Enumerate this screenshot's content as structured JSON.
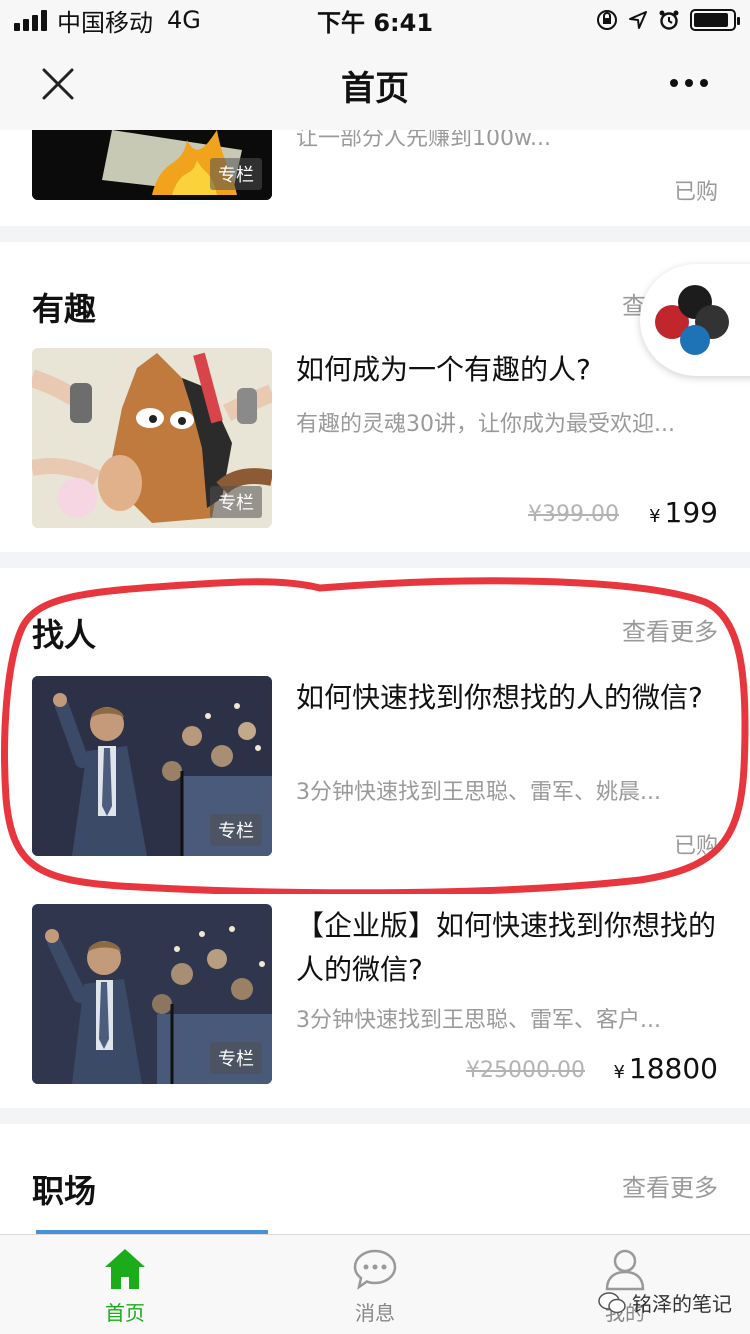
{
  "status_bar": {
    "carrier": "中国移动",
    "network": "4G",
    "time": "下午 6:41",
    "battery_level": 0.9
  },
  "nav": {
    "title": "首页"
  },
  "top_item": {
    "desc": "让一部分人先赚到100w...",
    "tag": "专栏",
    "status": "已购"
  },
  "sections": [
    {
      "title": "有趣",
      "see_more": "查看更多",
      "items": [
        {
          "title": "如何成为一个有趣的人?",
          "desc": "有趣的灵魂30讲，让你成为最受欢迎...",
          "tag": "专栏",
          "old_price": "¥399.00",
          "currency": "¥",
          "price": "199"
        }
      ]
    },
    {
      "title": "找人",
      "see_more": "查看更多",
      "items": [
        {
          "title": "如何快速找到你想找的人的微信?",
          "desc": "3分钟快速找到王思聪、雷军、姚晨...",
          "tag": "专栏",
          "status": "已购"
        },
        {
          "title": "【企业版】如何快速找到你想找的人的微信?",
          "desc": "3分钟快速找到王思聪、雷军、客户...",
          "tag": "专栏",
          "old_price": "¥25000.00",
          "currency": "¥",
          "price": "18800"
        }
      ]
    },
    {
      "title": "职场",
      "see_more": "查看更多"
    }
  ],
  "tab_bar": {
    "items": [
      {
        "label": "首页"
      },
      {
        "label": "消息"
      },
      {
        "label": "我的"
      }
    ]
  },
  "watermark": "铭泽的笔记",
  "colors": {
    "accent": "#1aad19",
    "highlight": "#e8363f"
  }
}
